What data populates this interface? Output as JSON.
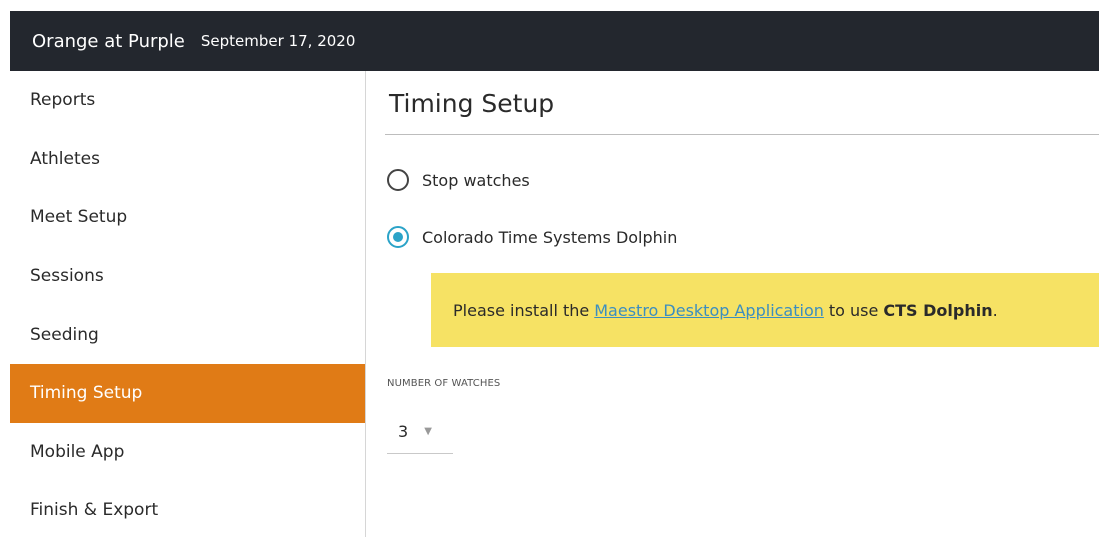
{
  "header": {
    "title": "Orange at Purple",
    "date": "September 17, 2020"
  },
  "sidebar": {
    "items": [
      {
        "label": "Reports"
      },
      {
        "label": "Athletes"
      },
      {
        "label": "Meet Setup"
      },
      {
        "label": "Sessions"
      },
      {
        "label": "Seeding"
      },
      {
        "label": "Timing Setup",
        "active": true
      },
      {
        "label": "Mobile App"
      },
      {
        "label": "Finish & Export"
      }
    ]
  },
  "main": {
    "title": "Timing Setup",
    "options": [
      {
        "label": "Stop watches",
        "selected": false
      },
      {
        "label": "Colorado Time Systems Dolphin",
        "selected": true
      }
    ],
    "notice": {
      "prefix": "Please install the",
      "link": "Maestro Desktop Application",
      "middle": "to use",
      "bold": "CTS Dolphin",
      "suffix": "."
    },
    "watches": {
      "label": "NUMBER OF WATCHES",
      "value": "3"
    }
  },
  "colors": {
    "header_bg": "#23272e",
    "accent": "#e07b16",
    "radio_selected": "#2ba3c8",
    "notice_bg": "#f6e264",
    "link": "#3b8ec0"
  }
}
